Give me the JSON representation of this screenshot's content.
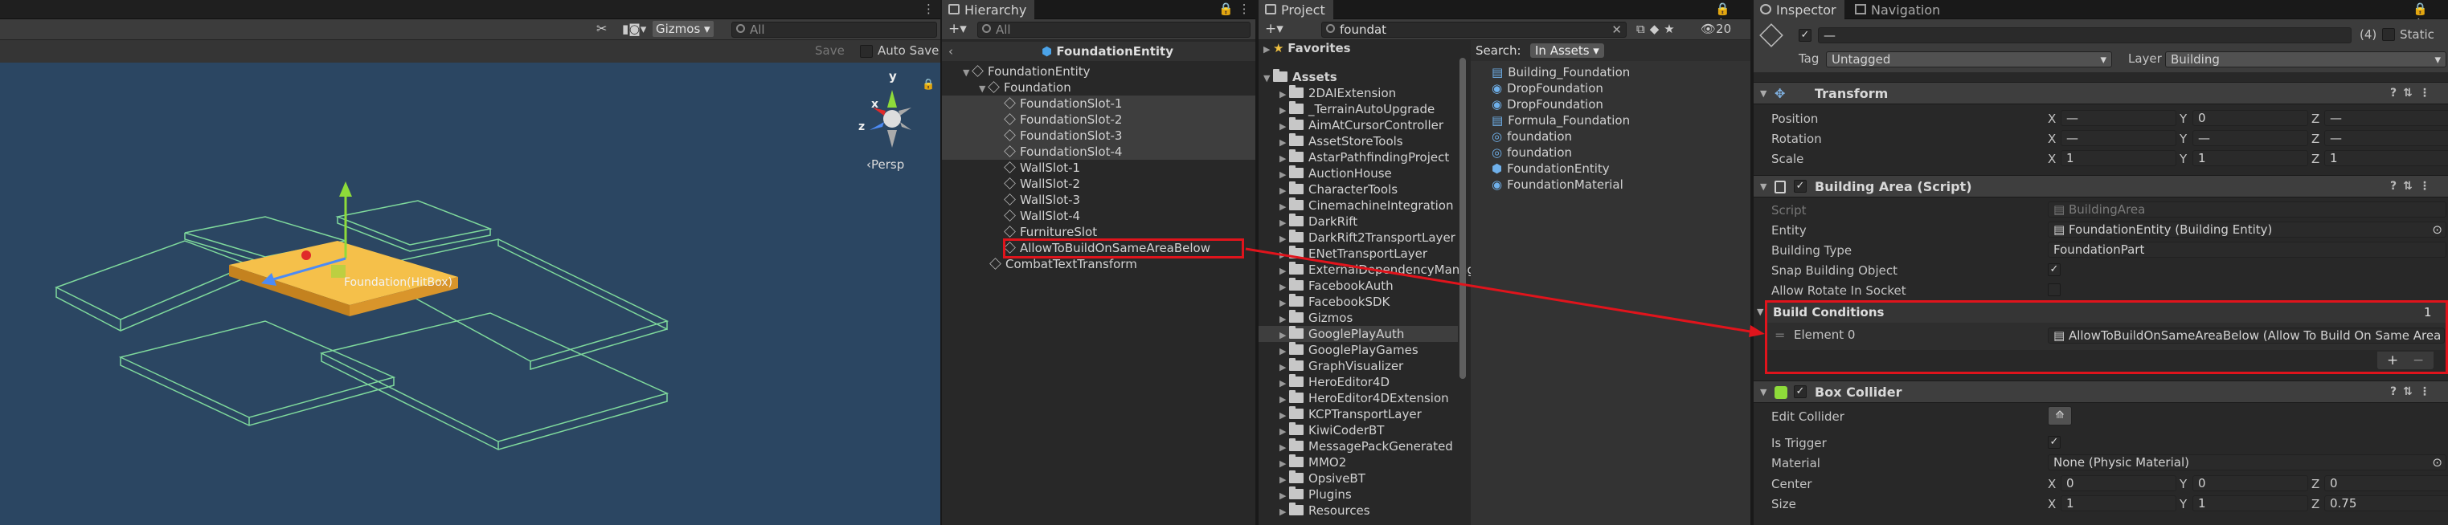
{
  "scene": {
    "gizmos_label": "Gizmos",
    "search_placeholder": "All",
    "save_label": "Save",
    "autosave_label": "Auto Save",
    "persp_label": "‹Persp",
    "object_label": "Foundation(HitBox)",
    "axis_x": "x",
    "axis_y": "y",
    "axis_z": "z"
  },
  "hierarchy": {
    "tab": "Hierarchy",
    "search_placeholder": "All",
    "scene_title": "FoundationEntity",
    "items": [
      "FoundationEntity",
      "Foundation",
      "FoundationSlot-1",
      "FoundationSlot-2",
      "FoundationSlot-3",
      "FoundationSlot-4",
      "WallSlot-1",
      "WallSlot-2",
      "WallSlot-3",
      "WallSlot-4",
      "FurnitureSlot",
      "AllowToBuildOnSameAreaBelow",
      "CombatTextTransform"
    ]
  },
  "project": {
    "tab": "Project",
    "search_value": "foundat",
    "search_label": "Search:",
    "search_scope": "In Assets",
    "count_badge": "20",
    "favorites": "Favorites",
    "assets": "Assets",
    "folders": [
      "2DAIExtension",
      "_TerrainAutoUpgrade",
      "AimAtCursorController",
      "AssetStoreTools",
      "AstarPathfindingProject",
      "AuctionHouse",
      "CharacterTools",
      "CinemachineIntegration",
      "DarkRift",
      "DarkRift2TransportLayer",
      "ENetTransportLayer",
      "ExternalDependencyManager",
      "FacebookAuth",
      "FacebookSDK",
      "Gizmos",
      "GooglePlayAuth",
      "GooglePlayGames",
      "GraphVisualizer",
      "HeroEditor4D",
      "HeroEditor4DExtension",
      "KCPTransportLayer",
      "KiwiCoderBT",
      "MessagePackGenerated",
      "MMO2",
      "OpsiveBT",
      "Plugins",
      "Resources"
    ],
    "results": [
      "Building_Foundation",
      "DropFoundation",
      "DropFoundation",
      "Formula_Foundation",
      "foundation",
      "foundation",
      "FoundationEntity",
      "FoundationMaterial"
    ]
  },
  "inspector": {
    "tab": "Inspector",
    "tab2": "Navigation",
    "name_value": "—",
    "count": "(4)",
    "static_label": "Static",
    "tag_label": "Tag",
    "tag_value": "Untagged",
    "layer_label": "Layer",
    "layer_value": "Building",
    "transform": {
      "title": "Transform",
      "position": "Position",
      "rotation": "Rotation",
      "scale": "Scale",
      "x": "X",
      "y": "Y",
      "z": "Z",
      "dash": "—",
      "zero": "0",
      "one": "1"
    },
    "building": {
      "title": "Building Area (Script)",
      "script_label": "Script",
      "script_value": "BuildingArea",
      "entity_label": "Entity",
      "entity_value": "FoundationEntity (Building Entity)",
      "type_label": "Building Type",
      "type_value": "FoundationPart",
      "snap_label": "Snap Building Object",
      "rotate_label": "Allow Rotate In Socket",
      "conditions_label": "Build Conditions",
      "conditions_count": "1",
      "element_label": "Element 0",
      "element_value": "AllowToBuildOnSameAreaBelow (Allow To Build On Same Area",
      "plus": "+",
      "minus": "−"
    },
    "box": {
      "title": "Box Collider",
      "edit_label": "Edit Collider",
      "trigger_label": "Is Trigger",
      "material_label": "Material",
      "material_value": "None (Physic Material)",
      "center_label": "Center",
      "size_label": "Size",
      "cx": "0",
      "cy": "0",
      "cz": "0",
      "sx": "1",
      "sy": "1",
      "sz": "0.75"
    }
  },
  "colors": {
    "scene_bg": "#2b4662",
    "highlight": "#e0141c",
    "selected_row": "#3e3e3e",
    "foundation": "#f5c04a"
  }
}
